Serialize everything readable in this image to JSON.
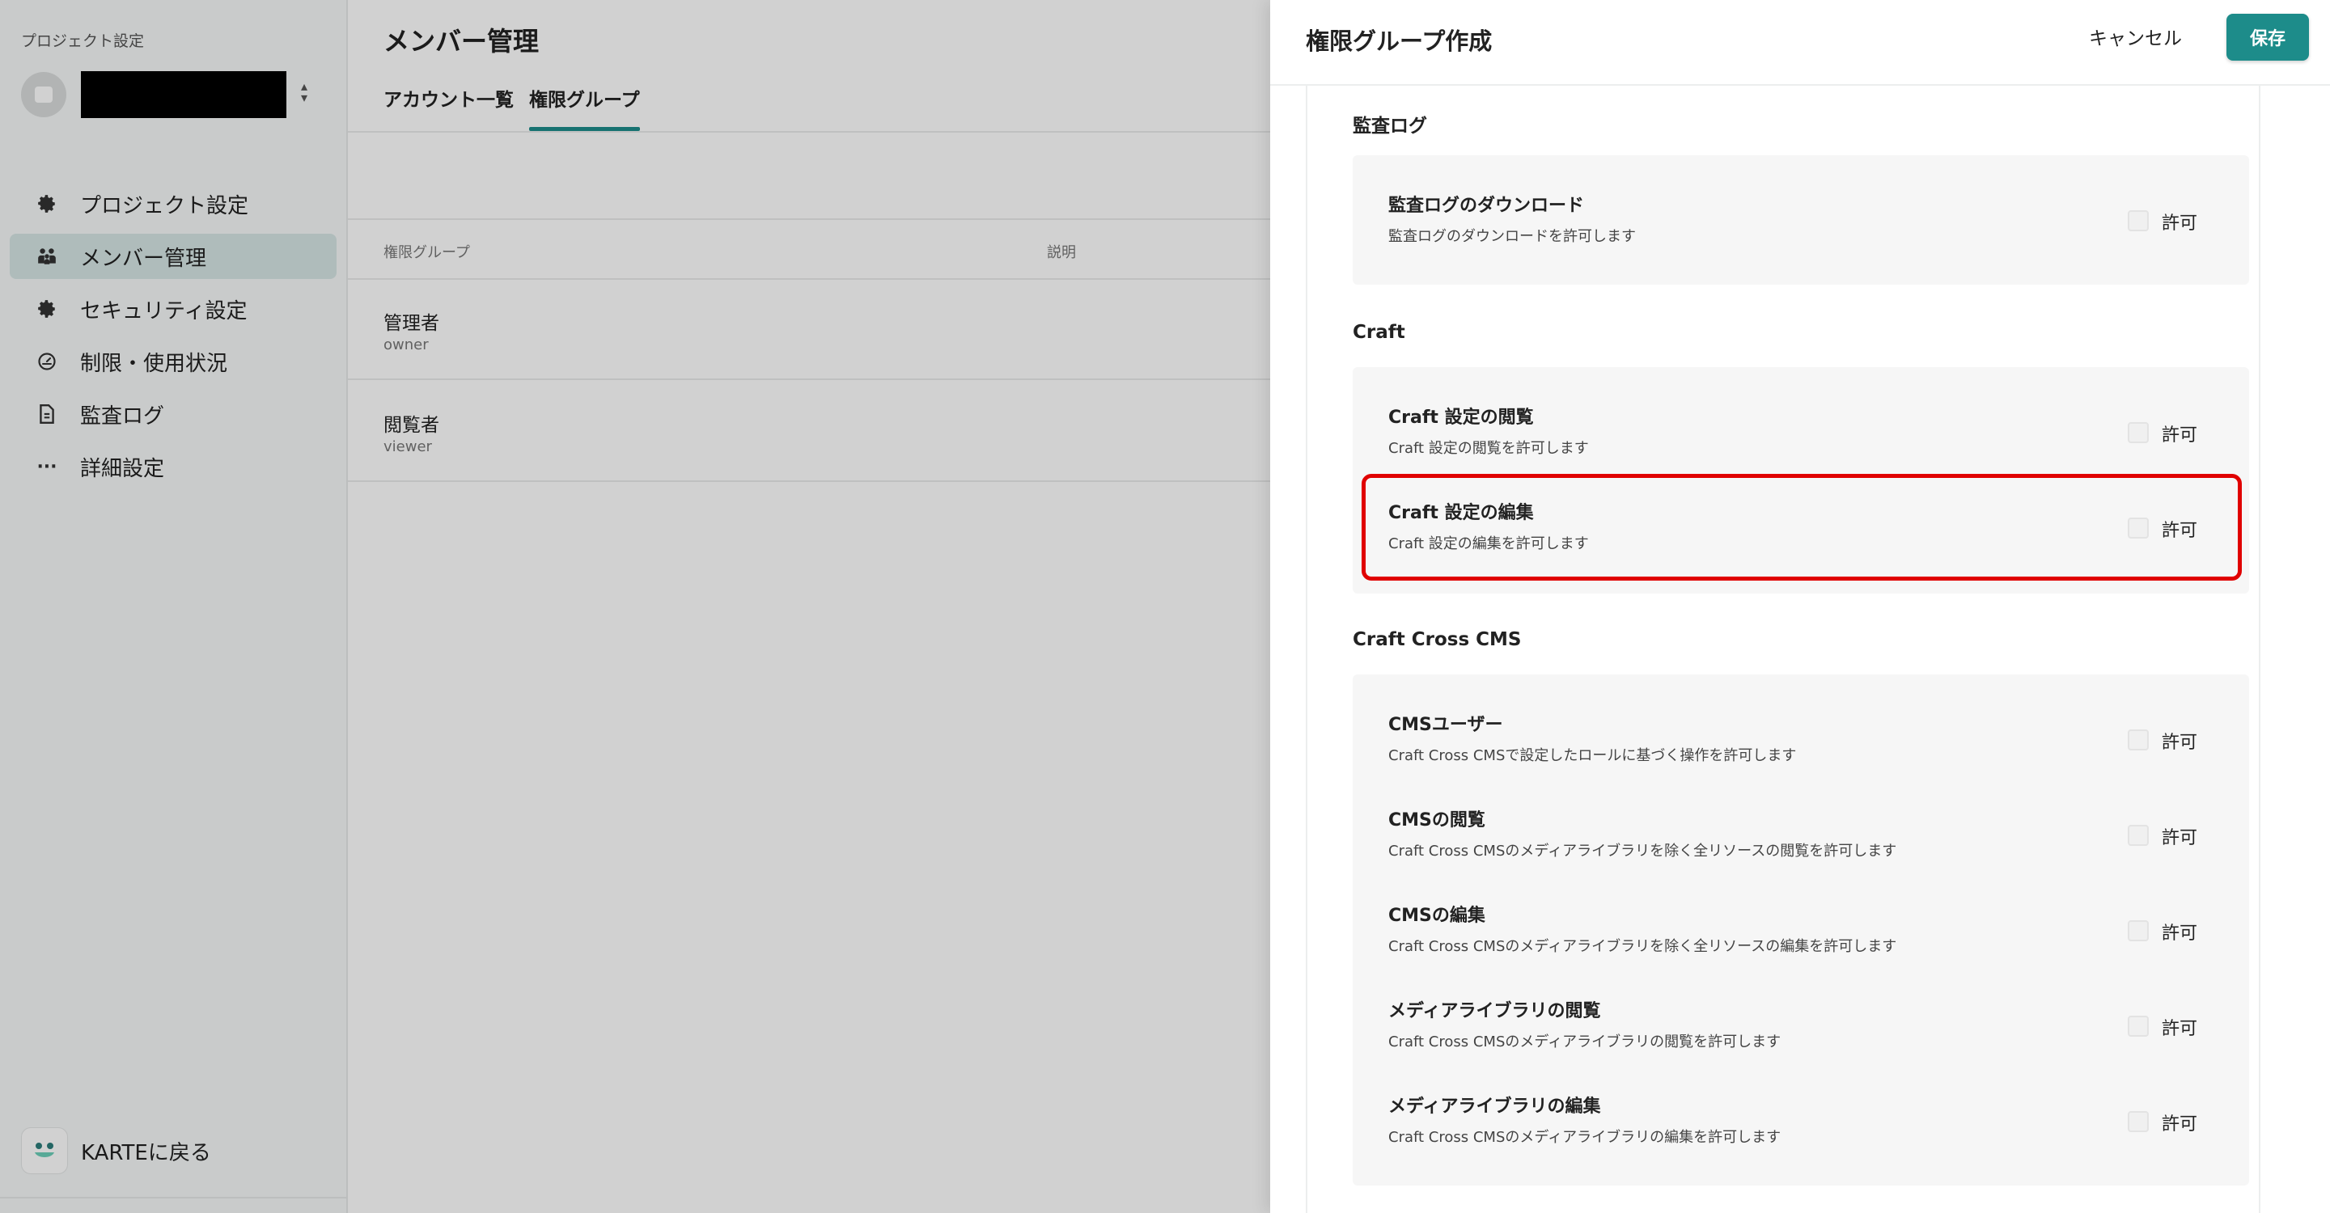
{
  "sidebar": {
    "caption": "プロジェクト設定",
    "project_name": "",
    "nav": [
      {
        "label": "プロジェクト設定",
        "icon": "gear-icon",
        "active": false
      },
      {
        "label": "メンバー管理",
        "icon": "members-icon",
        "active": true
      },
      {
        "label": "セキュリティ設定",
        "icon": "gear-icon",
        "active": false
      },
      {
        "label": "制限・使用状況",
        "icon": "gauge-icon",
        "active": false
      },
      {
        "label": "監査ログ",
        "icon": "document-icon",
        "active": false
      },
      {
        "label": "詳細設定",
        "icon": "more-icon",
        "active": false
      }
    ],
    "back_label": "KARTEに戻る"
  },
  "main": {
    "title": "メンバー管理",
    "tabs": [
      {
        "label": "アカウント一覧",
        "active": false
      },
      {
        "label": "権限グループ",
        "active": true
      }
    ],
    "table": {
      "headers": [
        "権限グループ",
        "説明"
      ],
      "rows": [
        {
          "name": "管理者",
          "key": "owner"
        },
        {
          "name": "閲覧者",
          "key": "viewer"
        }
      ]
    }
  },
  "drawer": {
    "title": "権限グループ作成",
    "cancel_label": "キャンセル",
    "save_label": "保存",
    "sections": [
      {
        "title": "監査ログ",
        "items": [
          {
            "title": "監査ログのダウンロード",
            "description": "監査ログのダウンロードを許可します",
            "checkbox_label": "許可",
            "checked": false
          }
        ]
      },
      {
        "title": "Craft",
        "items": [
          {
            "title": "Craft 設定の閲覧",
            "description": "Craft 設定の閲覧を許可します",
            "checkbox_label": "許可",
            "checked": false
          },
          {
            "title": "Craft 設定の編集",
            "description": "Craft 設定の編集を許可します",
            "checkbox_label": "許可",
            "checked": false,
            "highlighted": true
          }
        ]
      },
      {
        "title": "Craft Cross CMS",
        "items": [
          {
            "title": "CMSユーザー",
            "description": "Craft Cross CMSで設定したロールに基づく操作を許可します",
            "checkbox_label": "許可",
            "checked": false
          },
          {
            "title": "CMSの閲覧",
            "description": "Craft Cross CMSのメディアライブラリを除く全リソースの閲覧を許可します",
            "checkbox_label": "許可",
            "checked": false
          },
          {
            "title": "CMSの編集",
            "description": "Craft Cross CMSのメディアライブラリを除く全リソースの編集を許可します",
            "checkbox_label": "許可",
            "checked": false
          },
          {
            "title": "メディアライブラリの閲覧",
            "description": "Craft Cross CMSのメディアライブラリの閲覧を許可します",
            "checkbox_label": "許可",
            "checked": false
          },
          {
            "title": "メディアライブラリの編集",
            "description": "Craft Cross CMSのメディアライブラリの編集を許可します",
            "checkbox_label": "許可",
            "checked": false
          }
        ]
      }
    ]
  },
  "colors": {
    "accent": "#1d8c8a",
    "sidebar_active_bg": "#d6e6e5",
    "highlight_border": "#e00000",
    "card_bg": "#f6f6f6"
  }
}
